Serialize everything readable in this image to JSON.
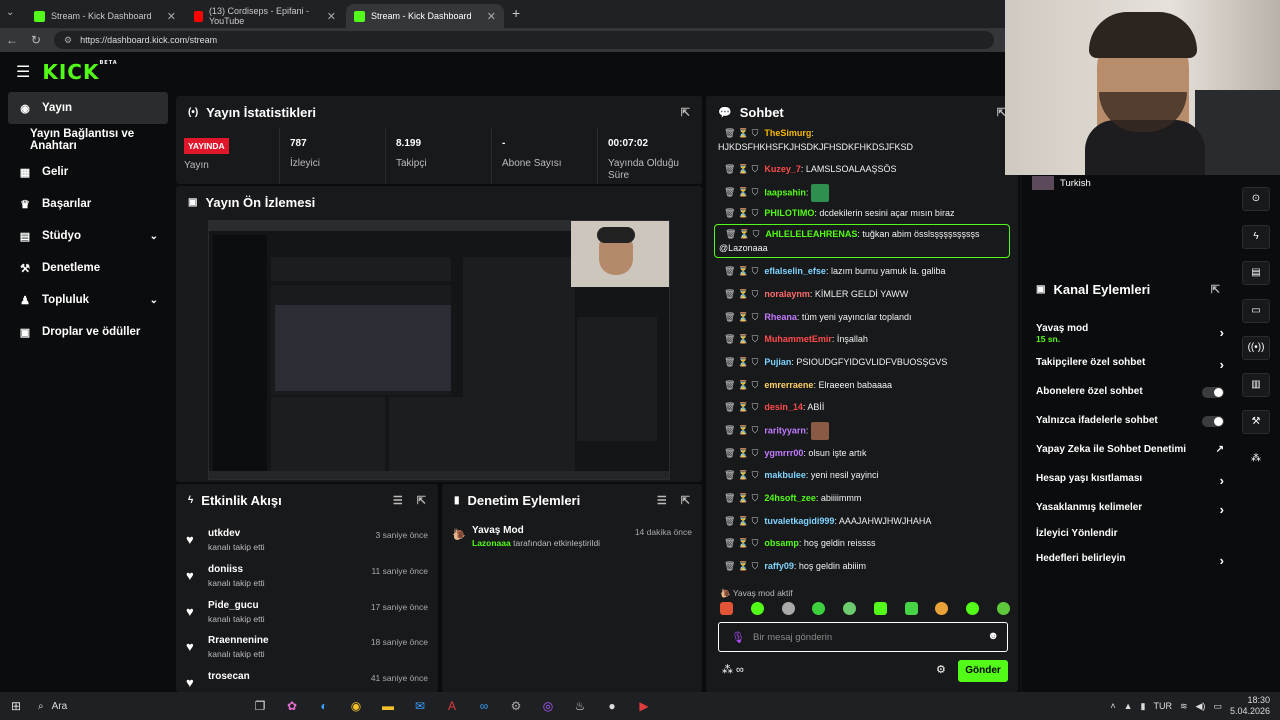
{
  "browser": {
    "tabs": [
      {
        "label": "Stream - Kick Dashboard",
        "active": false
      },
      {
        "label": "(13) Cordiseps - Epifani - YouTube",
        "active": false
      },
      {
        "label": "Stream - Kick Dashboard",
        "active": true
      }
    ],
    "url": "https://dashboard.kick.com/stream"
  },
  "logo": {
    "text": "KICK",
    "badge": "BETA"
  },
  "sidebar": {
    "items": [
      {
        "label": "Yayın",
        "icon": "broadcast-icon"
      },
      {
        "label": "Yayın Bağlantısı ve Anahtarı",
        "icon": ""
      },
      {
        "label": "Gelir",
        "icon": "revenue-icon"
      },
      {
        "label": "Başarılar",
        "icon": "trophy-icon"
      },
      {
        "label": "Stüdyo",
        "icon": "studio-icon"
      },
      {
        "label": "Denetleme",
        "icon": "moderation-icon"
      },
      {
        "label": "Topluluk",
        "icon": "community-icon"
      },
      {
        "label": "Droplar ve ödüller",
        "icon": "drops-icon"
      }
    ]
  },
  "stats": {
    "title": "Yayın İstatistikleri",
    "live_badge": "YAYINDA",
    "live_label": "Yayın",
    "cells": [
      {
        "value": "787",
        "label": "İzleyici"
      },
      {
        "value": "8.199",
        "label": "Takipçi"
      },
      {
        "value": "-",
        "label": "Abone Sayısı"
      },
      {
        "value": "00:07:02",
        "label": "Yayında Olduğu Süre"
      }
    ]
  },
  "preview": {
    "title": "Yayın Ön İzlemesi"
  },
  "activity": {
    "title": "Etkinlik Akışı",
    "items": [
      {
        "name": "utkdev",
        "action": "kanalı takip etti",
        "time": "3 saniye önce"
      },
      {
        "name": "doniiss",
        "action": "kanalı takip etti",
        "time": "11 saniye önce"
      },
      {
        "name": "Pide_gucu",
        "action": "kanalı takip etti",
        "time": "17 saniye önce"
      },
      {
        "name": "Rraennenine",
        "action": "kanalı takip etti",
        "time": "18 saniye önce"
      },
      {
        "name": "trosecan",
        "action": "",
        "time": "41 saniye önce"
      }
    ]
  },
  "modlog": {
    "title": "Denetim Eylemleri",
    "items": [
      {
        "title": "Yavaş Mod",
        "user": "Lazonaaa",
        "rest": "tarafından etkinleştirildi",
        "time": "14 dakika önce"
      }
    ]
  },
  "chat": {
    "title": "Sohbet",
    "messages": [
      {
        "user": "TheSimurg",
        "text": ":",
        "color": "#f5b800"
      },
      {
        "user": "",
        "text": "HJKDSFHKHSFKJHSDKJFHSDKFHKDSJFKSD",
        "color": "#ffffff"
      },
      {
        "user": "Kuzey_7",
        "text": ": LAMSLSOALAAŞSÖS",
        "color": "#ff4b4b"
      },
      {
        "user": "laapsahin",
        "text": ":",
        "color": "#53fc18"
      },
      {
        "user": "PHILOTIMO",
        "text": ": dcdekilerin sesini açar mısın biraz",
        "color": "#53fc18"
      },
      {
        "user": "AHLELELEAHRENAS",
        "text": ": tuğkan abim össlsşşşşsşşsşs",
        "color": "#53fc18"
      },
      {
        "user": "",
        "text": "@Lazonaaa",
        "color": "#ffffff"
      },
      {
        "user": "eflalselin_efse",
        "text": ": lazım burnu yamuk la. galiba",
        "color": "#7fd4ff"
      },
      {
        "user": "noralaynm",
        "text": ": KİMLER GELDİ YAWW",
        "color": "#ff6a6a"
      },
      {
        "user": "Rheana",
        "text": ": tüm yeni yayıncılar toplandı",
        "color": "#c07bff"
      },
      {
        "user": "MuhammetEmir",
        "text": ": İnşallah",
        "color": "#ff4b4b"
      },
      {
        "user": "Pujian",
        "text": ": PSIOUDGFYIDGVLIDFVBUOSŞGVS",
        "color": "#7fd4ff"
      },
      {
        "user": "emrerraene",
        "text": ": Elraeeen babaaaa",
        "color": "#ffd166"
      },
      {
        "user": "desin_14",
        "text": ": ABİİ",
        "color": "#ff4b4b"
      },
      {
        "user": "rarityyarn",
        "text": ":",
        "color": "#c07bff"
      },
      {
        "user": "ygmrrr00",
        "text": ": olsun işte artık",
        "color": "#c07bff"
      },
      {
        "user": "makbulee",
        "text": ": yeni nesil yayinci",
        "color": "#7fd4ff"
      },
      {
        "user": "24hsoft_zee",
        "text": ": abiiiimmm",
        "color": "#53fc18"
      },
      {
        "user": "tuvaletkagidi999",
        "text": ": AAAJAHWJHWJHAHA",
        "color": "#7fd4ff"
      },
      {
        "user": "obsamp",
        "text": ": hoş geldin reissss",
        "color": "#53fc18"
      },
      {
        "user": "raffy09",
        "text": ": hoş geldin abiiim",
        "color": "#7fd4ff"
      }
    ],
    "slow_mode_text": "Yavaş mod aktif",
    "input_placeholder": "Bir mesaj gönderin",
    "send_label": "Gönder"
  },
  "webcam": {
    "language_badge": "Turkish"
  },
  "channel_actions": {
    "title": "Kanal Eylemleri",
    "items": [
      {
        "label": "Yavaş mod",
        "sub": "15 sn.",
        "control": "arrow"
      },
      {
        "label": "Takipçilere özel sohbet",
        "control": "arrow"
      },
      {
        "label": "Abonelere özel sohbet",
        "control": "toggle"
      },
      {
        "label": "Yalnızca ifadelerle sohbet",
        "control": "toggle"
      },
      {
        "label": "Yapay Zeka ile Sohbet Denetimi",
        "control": "external"
      },
      {
        "label": "Hesap yaşı kısıtlaması",
        "control": "arrow"
      },
      {
        "label": "Yasaklanmış kelimeler",
        "control": "arrow"
      },
      {
        "label": "İzleyici Yönlendir",
        "control": "none"
      },
      {
        "label": "Hedefleri belirleyin",
        "control": "arrow"
      }
    ]
  },
  "taskbar": {
    "search_label": "Ara",
    "language": "TUR",
    "time": "18:30",
    "date": "5.04.2026"
  },
  "colors": {
    "accent": "#53fc18",
    "live": "#e0162b",
    "panel": "#18191b"
  }
}
